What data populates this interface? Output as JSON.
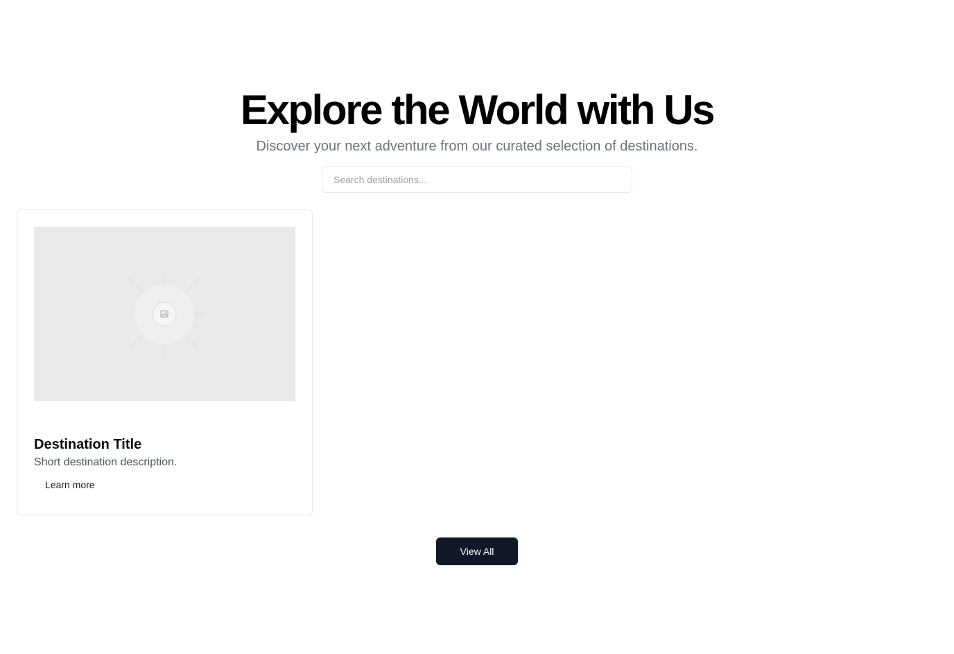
{
  "hero": {
    "title": "Explore the World with Us",
    "subtitle": "Discover your next adventure from our curated selection of destinations."
  },
  "search": {
    "placeholder": "Search destinations...",
    "value": ""
  },
  "destinations": [
    {
      "image_icon": "image-placeholder-icon",
      "title": "Destination Title",
      "description": "Short destination description.",
      "link_label": "Learn more"
    }
  ],
  "actions": {
    "view_all_label": "View All"
  },
  "colors": {
    "primary_button": "#111827",
    "image_placeholder": "#e9e9e9",
    "muted_text": "#6b7280",
    "border": "#e5e7eb"
  }
}
